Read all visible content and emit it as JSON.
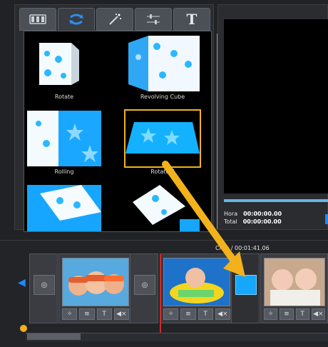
{
  "toolbar": {
    "tabs": [
      {
        "icon": "film-icon"
      },
      {
        "icon": "transition-icon"
      },
      {
        "icon": "magic-wand-icon"
      },
      {
        "icon": "sliders-icon"
      },
      {
        "icon": "text-icon",
        "label": "T"
      }
    ]
  },
  "gallery": {
    "items": [
      {
        "label": "Rotate"
      },
      {
        "label": "Revolving Cube"
      },
      {
        "label": "Rolling"
      },
      {
        "label": "Rotate II",
        "selected": true
      },
      {
        "label": ""
      },
      {
        "label": ""
      }
    ]
  },
  "preview": {
    "hora_label": "Hora",
    "hora_value": "00:00:00.00",
    "total_label": "Total",
    "total_value": "00:00:00.00"
  },
  "timeline": {
    "clips_header": "Clips / 00:01:41.06"
  },
  "colors": {
    "accent": "#1e88ff",
    "selection": "#f3b21b",
    "marker": "#d02a2a"
  }
}
